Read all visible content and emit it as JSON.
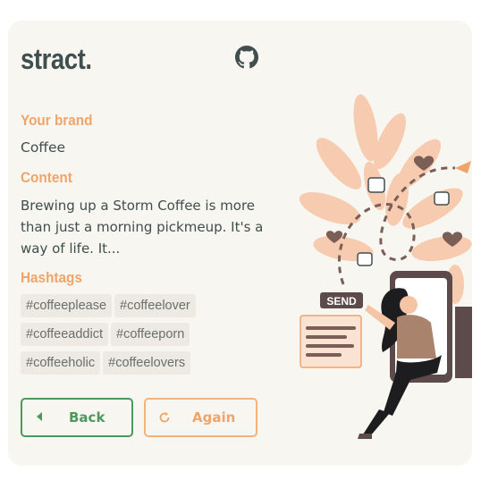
{
  "brand": {
    "logo": "stract."
  },
  "header": {
    "github_icon": "github-icon"
  },
  "fields": {
    "brand_label": "Your brand",
    "brand_value": "Coffee",
    "content_label": "Content",
    "content_value": "Brewing up a Storm Coffee is more than just a morning pickmeup. It's a way of life. It...",
    "hashtags_label": "Hashtags"
  },
  "hashtags": [
    "#coffeeplease",
    "#coffeelover",
    "#coffeeaddict",
    "#coffeeporn",
    "#coffeeholic",
    "#coffeelovers"
  ],
  "buttons": {
    "back_label": "Back",
    "back_icon": "caret-left-icon",
    "again_label": "Again",
    "again_icon": "refresh-icon"
  },
  "illustration": {
    "send_label": "SEND"
  },
  "colors": {
    "accent_orange": "#f0a46a",
    "accent_green": "#4a9a5d",
    "text_dark": "#404e4d",
    "card_bg": "#f7f6f1"
  }
}
